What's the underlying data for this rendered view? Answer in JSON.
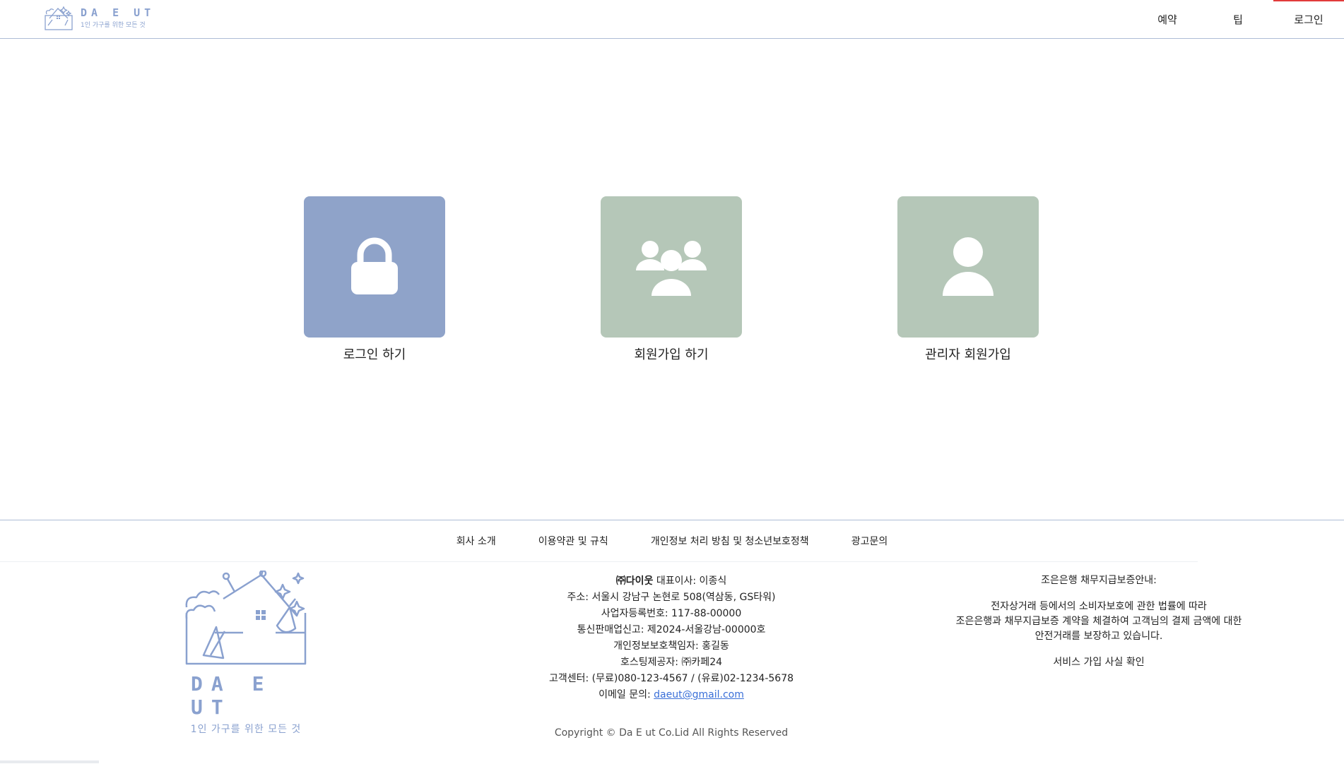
{
  "header": {
    "logo_title": "DA E UT",
    "logo_sub": "1인 가구를 위한 모든 것",
    "nav": [
      {
        "label": "예약"
      },
      {
        "label": "팁"
      },
      {
        "label": "로그인"
      }
    ]
  },
  "cards": {
    "login": {
      "label": "로그인 하기",
      "color": "#8fa3c9",
      "icon": "lock-icon"
    },
    "signup": {
      "label": "회원가입 하기",
      "color": "#b5c7b8",
      "icon": "users-icon"
    },
    "admin": {
      "label": "관리자 회원가입",
      "color": "#b5c7b8",
      "icon": "user-icon"
    }
  },
  "footer": {
    "nav": [
      {
        "label": "회사 소개"
      },
      {
        "label": "이용약관 및 규칙"
      },
      {
        "label": "개인정보 처리 방침 및 청소년보호정책"
      },
      {
        "label": "광고문의"
      }
    ],
    "logo_title": "DA E UT",
    "logo_sub": "1인 가구를 위한 모든 것",
    "company": {
      "name": "㈜다이웃",
      "ceo": "대표이사: 이종식",
      "address": "주소: 서울시 강남구 논현로 508(역삼동, GS타워)",
      "biz_no": "사업자등록번호: 117-88-00000",
      "mail_order": "통신판매업신고: 제2024-서울강남-00000호",
      "privacy_officer": "개인정보보호책임자: 홍길동",
      "hosting": "호스팅제공자: ㈜카페24",
      "cs": "고객센터: (무료)080-123-4567 / (유료)02-1234-5678",
      "email_label": "이메일 문의: ",
      "email": "daeut@gmail.com"
    },
    "copyright": "Copyright © Da E ut Co.Lid All Rights Reserved",
    "escrow": {
      "title": "조은은행 채무지급보증안내:",
      "line1": "전자상거래 등에서의 소비자보호에 관한 법률에 따라",
      "line2": "조은은행과 채무지급보증 계약을 체결하여 고객님의 결제 금액에 대한",
      "line3": "안전거래를 보장하고 있습니다.",
      "link": "서비스 가입 사실 확인"
    }
  },
  "colors": {
    "accent": "#8aa1cf",
    "active_nav": "#e23b3b",
    "link": "#3a6fd8"
  }
}
